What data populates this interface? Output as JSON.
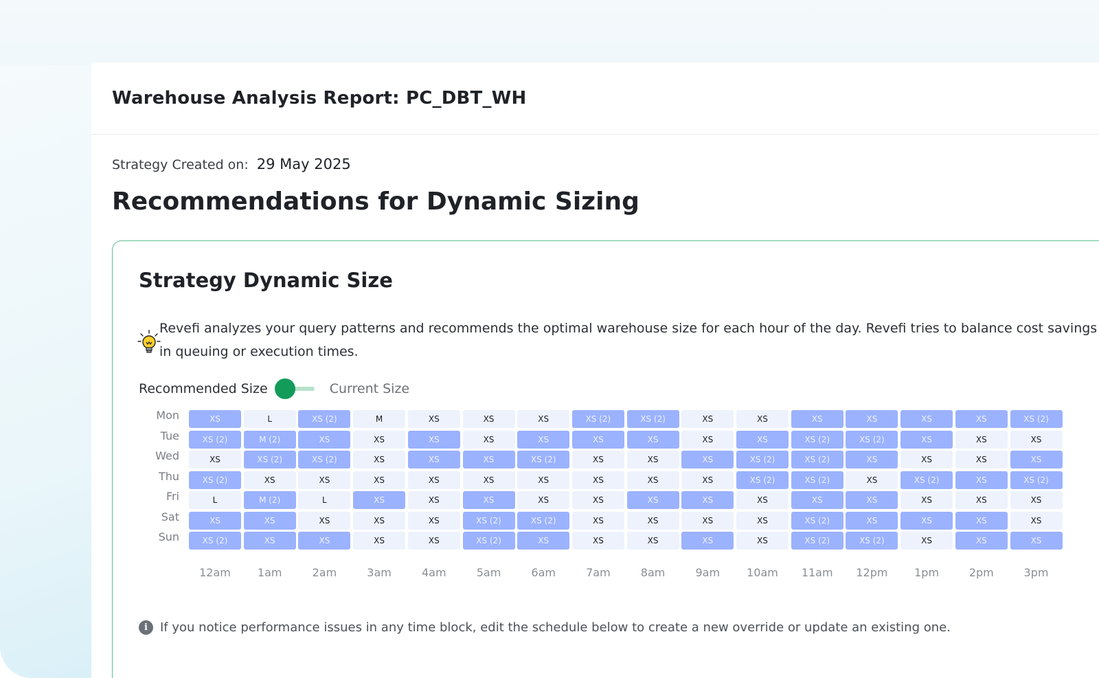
{
  "report": {
    "title": "Warehouse Analysis Report: PC_DBT_WH",
    "created_label": "Strategy Created on:",
    "created_value": "29 May 2025",
    "section_title": "Recommendations for Dynamic Sizing"
  },
  "card": {
    "title": "Strategy Dynamic Size",
    "description_line1": "Revefi analyzes your query patterns and recommends the optimal warehouse size for each hour of the day. Revefi tries to balance cost savings wit",
    "description_line2": "in queuing or execution times.",
    "icon": "lightbulb-icon"
  },
  "toggle": {
    "left_label": "Recommended Size",
    "right_label": "Current Size",
    "selected": "Recommended Size",
    "accent": "#139b5a"
  },
  "heatmap": {
    "days": [
      "Mon",
      "Tue",
      "Wed",
      "Thu",
      "Fri",
      "Sat",
      "Sun"
    ],
    "hours": [
      "12am",
      "1am",
      "2am",
      "3am",
      "4am",
      "5am",
      "6am",
      "7am",
      "8am",
      "9am",
      "10am",
      "11am",
      "12pm",
      "1pm",
      "2pm",
      "3pm"
    ],
    "colors": {
      "highlight": "#9bb2ff",
      "base": "#eef2fd"
    },
    "rows": [
      [
        [
          "XS",
          "h"
        ],
        [
          "L",
          "b"
        ],
        [
          "XS (2)",
          "h"
        ],
        [
          "M",
          "b"
        ],
        [
          "XS",
          "b"
        ],
        [
          "XS",
          "b"
        ],
        [
          "XS",
          "b"
        ],
        [
          "XS (2)",
          "h"
        ],
        [
          "XS (2)",
          "h"
        ],
        [
          "XS",
          "b"
        ],
        [
          "XS",
          "b"
        ],
        [
          "XS",
          "h"
        ],
        [
          "XS",
          "h"
        ],
        [
          "XS",
          "h"
        ],
        [
          "XS",
          "h"
        ],
        [
          "XS (2)",
          "h"
        ]
      ],
      [
        [
          "XS (2)",
          "h"
        ],
        [
          "M (2)",
          "h"
        ],
        [
          "XS",
          "h"
        ],
        [
          "XS",
          "b"
        ],
        [
          "XS",
          "h"
        ],
        [
          "XS",
          "b"
        ],
        [
          "XS",
          "h"
        ],
        [
          "XS",
          "h"
        ],
        [
          "XS",
          "h"
        ],
        [
          "XS",
          "b"
        ],
        [
          "XS",
          "h"
        ],
        [
          "XS (2)",
          "h"
        ],
        [
          "XS (2)",
          "h"
        ],
        [
          "XS",
          "h"
        ],
        [
          "XS",
          "b"
        ],
        [
          "XS",
          "b"
        ]
      ],
      [
        [
          "XS",
          "b"
        ],
        [
          "XS (2)",
          "h"
        ],
        [
          "XS (2)",
          "h"
        ],
        [
          "XS",
          "b"
        ],
        [
          "XS",
          "h"
        ],
        [
          "XS",
          "h"
        ],
        [
          "XS (2)",
          "h"
        ],
        [
          "XS",
          "b"
        ],
        [
          "XS",
          "b"
        ],
        [
          "XS",
          "h"
        ],
        [
          "XS (2)",
          "h"
        ],
        [
          "XS (2)",
          "h"
        ],
        [
          "XS",
          "h"
        ],
        [
          "XS",
          "b"
        ],
        [
          "XS",
          "b"
        ],
        [
          "XS",
          "h"
        ]
      ],
      [
        [
          "XS (2)",
          "h"
        ],
        [
          "XS",
          "b"
        ],
        [
          "XS",
          "b"
        ],
        [
          "XS",
          "b"
        ],
        [
          "XS",
          "b"
        ],
        [
          "XS",
          "b"
        ],
        [
          "XS",
          "b"
        ],
        [
          "XS",
          "b"
        ],
        [
          "XS",
          "b"
        ],
        [
          "XS",
          "b"
        ],
        [
          "XS (2)",
          "h"
        ],
        [
          "XS (2)",
          "h"
        ],
        [
          "XS",
          "b"
        ],
        [
          "XS (2)",
          "h"
        ],
        [
          "XS",
          "h"
        ],
        [
          "XS (2)",
          "h"
        ]
      ],
      [
        [
          "L",
          "b"
        ],
        [
          "M (2)",
          "h"
        ],
        [
          "L",
          "b"
        ],
        [
          "XS",
          "h"
        ],
        [
          "XS",
          "b"
        ],
        [
          "XS",
          "h"
        ],
        [
          "XS",
          "b"
        ],
        [
          "XS",
          "b"
        ],
        [
          "XS",
          "h"
        ],
        [
          "XS",
          "h"
        ],
        [
          "XS",
          "b"
        ],
        [
          "XS",
          "h"
        ],
        [
          "XS",
          "h"
        ],
        [
          "XS",
          "b"
        ],
        [
          "XS",
          "b"
        ],
        [
          "XS",
          "b"
        ]
      ],
      [
        [
          "XS",
          "h"
        ],
        [
          "XS",
          "h"
        ],
        [
          "XS",
          "b"
        ],
        [
          "XS",
          "b"
        ],
        [
          "XS",
          "b"
        ],
        [
          "XS (2)",
          "h"
        ],
        [
          "XS (2)",
          "h"
        ],
        [
          "XS",
          "b"
        ],
        [
          "XS",
          "b"
        ],
        [
          "XS",
          "b"
        ],
        [
          "XS",
          "b"
        ],
        [
          "XS (2)",
          "h"
        ],
        [
          "XS",
          "h"
        ],
        [
          "XS",
          "h"
        ],
        [
          "XS",
          "h"
        ],
        [
          "XS",
          "b"
        ]
      ],
      [
        [
          "XS (2)",
          "h"
        ],
        [
          "XS",
          "h"
        ],
        [
          "XS",
          "h"
        ],
        [
          "XS",
          "b"
        ],
        [
          "XS",
          "b"
        ],
        [
          "XS (2)",
          "h"
        ],
        [
          "XS",
          "h"
        ],
        [
          "XS",
          "b"
        ],
        [
          "XS",
          "b"
        ],
        [
          "XS",
          "h"
        ],
        [
          "XS",
          "b"
        ],
        [
          "XS (2)",
          "h"
        ],
        [
          "XS (2)",
          "h"
        ],
        [
          "XS",
          "b"
        ],
        [
          "XS",
          "h"
        ],
        [
          "XS",
          "h"
        ]
      ]
    ]
  },
  "info": {
    "icon": "info-icon",
    "text": "If you notice performance issues in any time block, edit the schedule below to create a new override or update an existing one."
  }
}
